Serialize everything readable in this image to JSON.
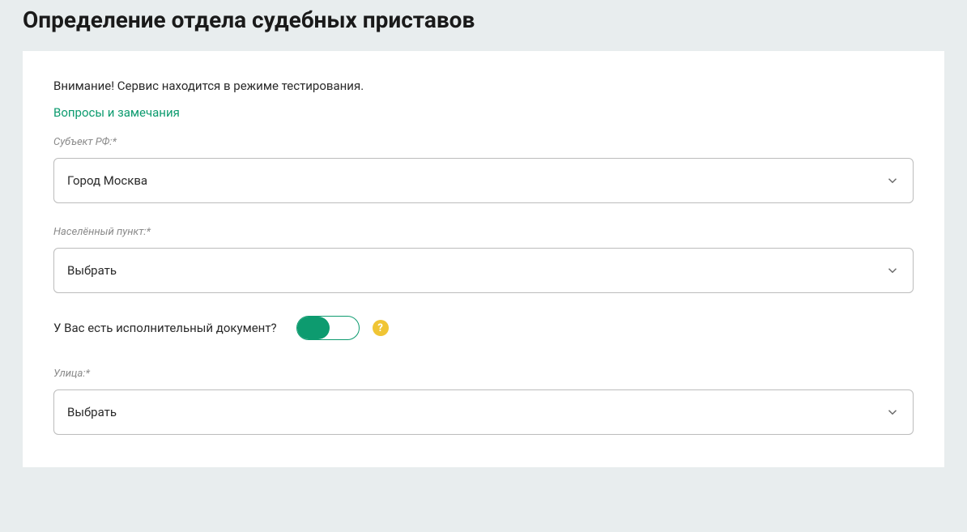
{
  "page": {
    "title": "Определение отдела судебных приставов"
  },
  "form": {
    "warning": "Внимание! Сервис находится в режиме тестирования.",
    "feedback_link": "Вопросы и замечания",
    "fields": {
      "subject": {
        "label": "Субъект РФ:*",
        "value": "Город Москва"
      },
      "locality": {
        "label": "Населённый пункт:*",
        "value": "Выбрать"
      },
      "street": {
        "label": "Улица:*",
        "value": "Выбрать"
      }
    },
    "toggle": {
      "label": "У Вас есть исполнительный документ?",
      "help": "?"
    }
  }
}
